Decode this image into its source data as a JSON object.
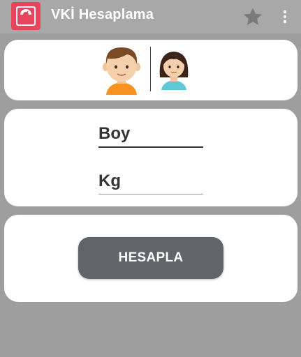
{
  "appbar": {
    "title": "VKİ Hesaplama",
    "app_icon": "scale-icon",
    "favorite_icon": "star-icon",
    "menu_icon": "more-vert-icon"
  },
  "gender": {
    "male_icon": "male-avatar-icon",
    "female_icon": "female-avatar-icon"
  },
  "inputs": {
    "height_placeholder": "Boy",
    "weight_placeholder": "Kg"
  },
  "action": {
    "calculate_label": "HESAPLA"
  },
  "colors": {
    "appbar": "#a8a8a8",
    "background": "#9e9e9e",
    "app_icon_bg": "#e8455d",
    "button": "#616567"
  }
}
